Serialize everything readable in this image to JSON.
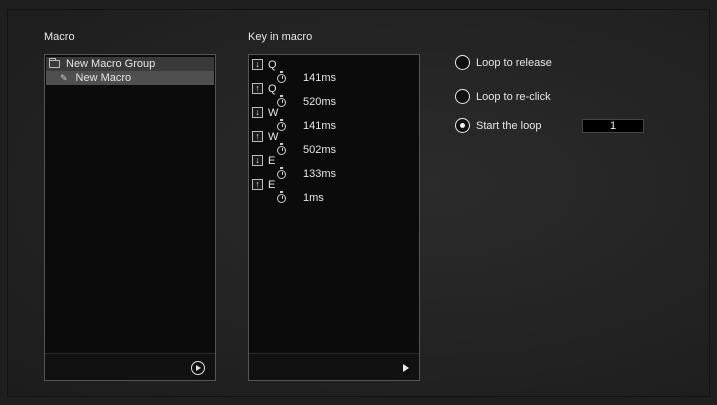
{
  "macro_section": {
    "title": "Macro",
    "group_label": "New Macro Group",
    "macro_label": "New Macro"
  },
  "keys_section": {
    "title": "Key in macro",
    "events": [
      {
        "direction": "down",
        "key": "Q",
        "delay": "141ms"
      },
      {
        "direction": "up",
        "key": "Q",
        "delay": "520ms"
      },
      {
        "direction": "down",
        "key": "W",
        "delay": "141ms"
      },
      {
        "direction": "up",
        "key": "W",
        "delay": "502ms"
      },
      {
        "direction": "down",
        "key": "E",
        "delay": "133ms"
      },
      {
        "direction": "up",
        "key": "E",
        "delay": "1ms"
      }
    ]
  },
  "loop_options": {
    "loop_to_release": "Loop to release",
    "loop_to_reclick": "Loop to re-click",
    "start_the_loop": "Start the loop",
    "selected": "start_the_loop",
    "loop_count": "1"
  },
  "icons": {
    "down": "↓",
    "up": "↑"
  }
}
